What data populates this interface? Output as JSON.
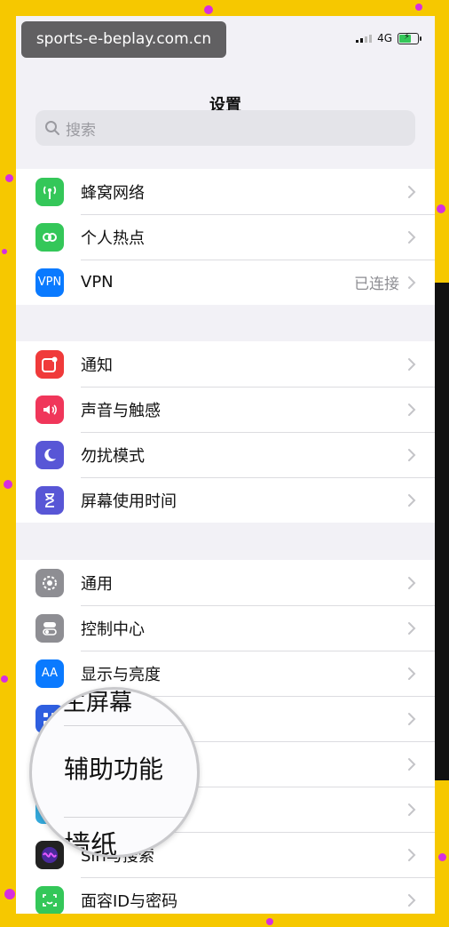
{
  "watermark": "sports-e-beplay.com.cn",
  "status": {
    "network": "4G"
  },
  "header": {
    "title": "设置"
  },
  "search": {
    "placeholder": "搜索"
  },
  "groups": [
    {
      "items": [
        {
          "label": "蜂窝网络",
          "icon": "antenna-icon",
          "color": "#34c759"
        },
        {
          "label": "个人热点",
          "icon": "hotspot-icon",
          "color": "#34c759"
        },
        {
          "label": "VPN",
          "icon": "vpn-icon",
          "icon_text": "VPN",
          "color": "#0a7aff",
          "value": "已连接"
        }
      ]
    },
    {
      "items": [
        {
          "label": "通知",
          "icon": "notification-icon",
          "color": "#f03a3a"
        },
        {
          "label": "声音与触感",
          "icon": "speaker-icon",
          "color": "#f0365a"
        },
        {
          "label": "勿扰模式",
          "icon": "moon-icon",
          "color": "#5856d6"
        },
        {
          "label": "屏幕使用时间",
          "icon": "hourglass-icon",
          "color": "#5856d6"
        }
      ]
    },
    {
      "items": [
        {
          "label": "通用",
          "icon": "gear-icon",
          "color": "#8e8e93"
        },
        {
          "label": "控制中心",
          "icon": "toggles-icon",
          "color": "#8e8e93"
        },
        {
          "label": "显示与亮度",
          "icon": "display-icon",
          "icon_text": "AA",
          "color": "#0a7aff"
        },
        {
          "label": "主屏幕",
          "icon": "home-screen-icon",
          "color": "#2f5fe0"
        },
        {
          "label": "辅助功能",
          "icon": "accessibility-icon",
          "color": "#0a7aff"
        },
        {
          "label": "墙纸",
          "icon": "wallpaper-icon",
          "color": "#35aadc"
        },
        {
          "label": "Siri与搜索",
          "icon": "siri-icon",
          "color": "#222222"
        },
        {
          "label": "面容ID与密码",
          "icon": "faceid-icon",
          "color": "#34c759"
        }
      ]
    }
  ],
  "magnifier": {
    "top": "主屏幕",
    "middle": "辅助功能",
    "bottom": "墙纸"
  }
}
